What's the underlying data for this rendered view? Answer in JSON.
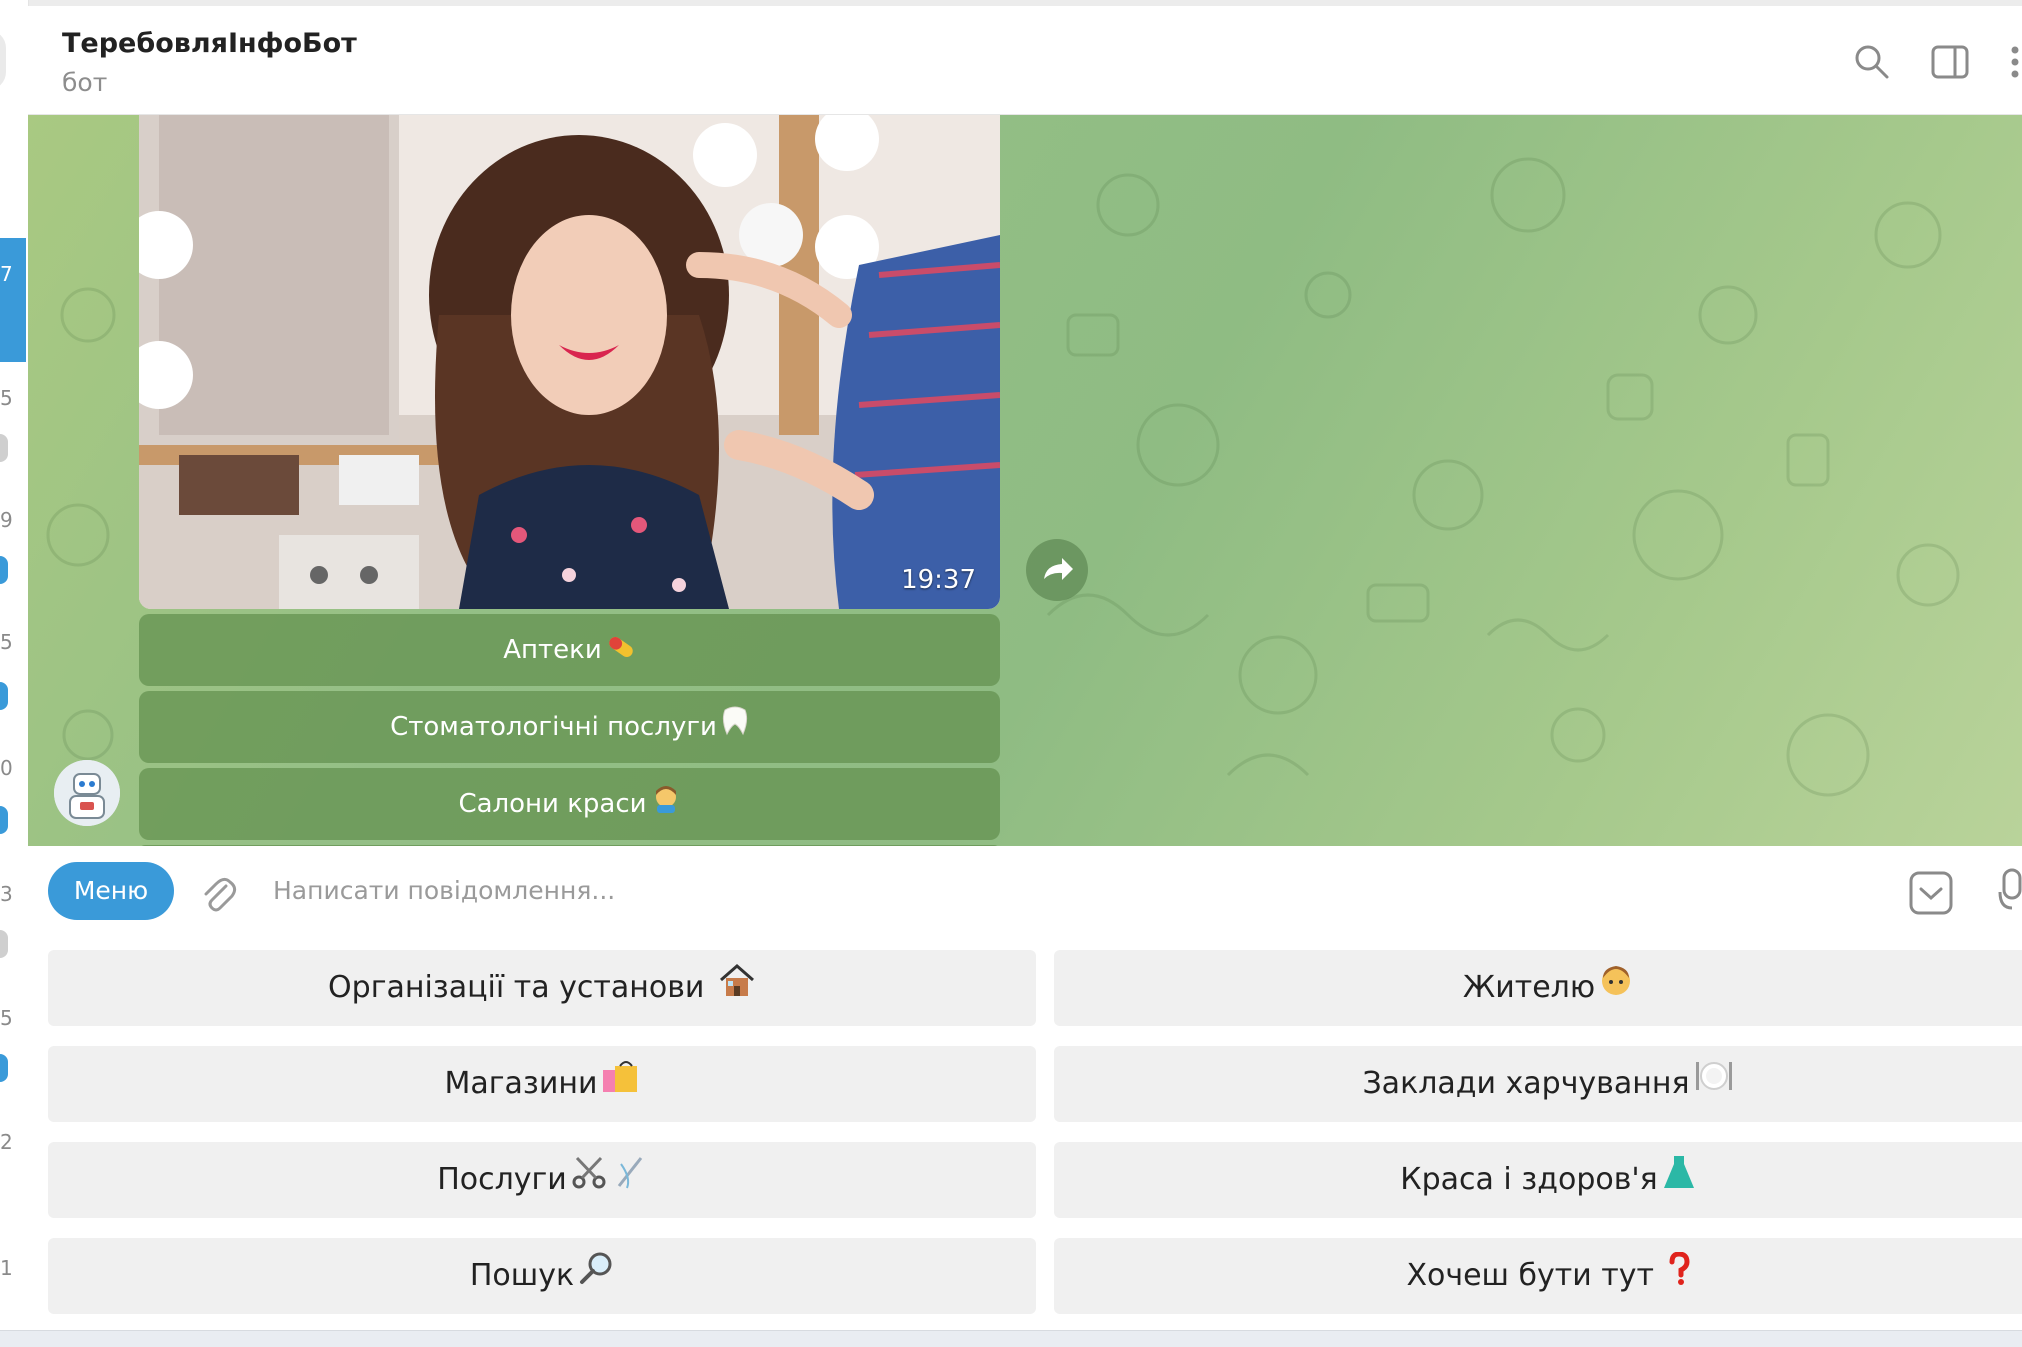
{
  "header": {
    "title": "ТеребовляІнфоБот",
    "subtitle": "бот"
  },
  "sidebar": {
    "badges": [
      "7",
      "5",
      "9",
      "5",
      "0",
      "3",
      "5",
      "2",
      "1"
    ]
  },
  "message": {
    "time": "19:37",
    "inline_buttons": [
      {
        "label": "Аптеки",
        "emoji": "pill-emoji"
      },
      {
        "label": "Стоматологічні послуги",
        "emoji": "tooth-emoji"
      },
      {
        "label": "Салони краси",
        "emoji": "haircut-emoji"
      }
    ]
  },
  "composer": {
    "menu_label": "Меню",
    "placeholder": "Написати повідомлення..."
  },
  "keyboard": {
    "buttons": [
      {
        "label": "Організації та установи ",
        "emoji": "house-emoji"
      },
      {
        "label": "Жителю",
        "emoji": "man-emoji"
      },
      {
        "label": "Магазини",
        "emoji": "shopping-bags-emoji"
      },
      {
        "label": "Заклади харчування",
        "emoji": "plate-emoji"
      },
      {
        "label": "Послуги",
        "emoji": "scissors-needle-emoji"
      },
      {
        "label": "Краса і здоров'я",
        "emoji": "dress-emoji"
      },
      {
        "label": "Пошук",
        "emoji": "magnifier-emoji"
      },
      {
        "label": "Хочеш бути тут ",
        "emoji": "question-mark-emoji"
      }
    ]
  },
  "colors": {
    "accent": "#3a9ad9",
    "chat_bg": "#94bf86",
    "inline_button": "#6b9556",
    "keyboard_button": "#f0f0f0"
  }
}
